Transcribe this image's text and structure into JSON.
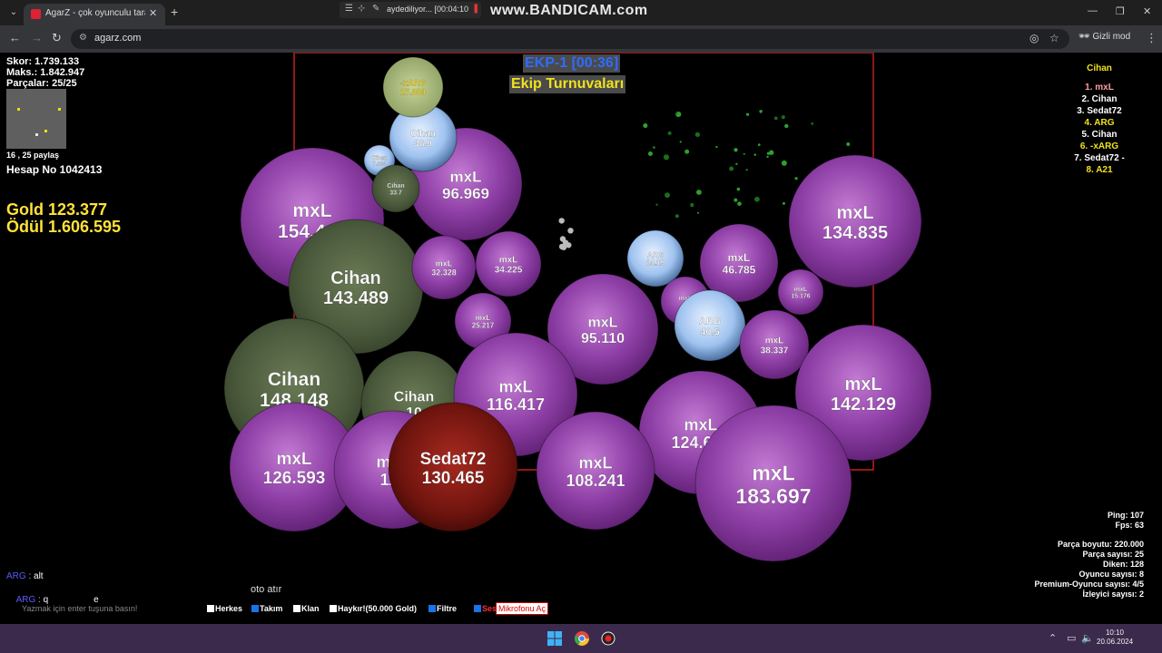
{
  "browser": {
    "tab_title": "AgarZ - çok oyunculu tarayıcı o",
    "url": "agarz.com",
    "incognito_label": "Gizli mod",
    "recorder_text": "aydediliyor... [00:04:10",
    "watermark": "www.BANDICAM.com"
  },
  "game": {
    "stats": {
      "score": "Skor: 1.739.133",
      "max": "Maks.: 1.842.947",
      "parts": "Parçalar: 25/25"
    },
    "share_text": "16 , 25 paylaş",
    "account": "Hesap No 1042413",
    "gold": "Gold 123.377",
    "reward": "Ödül 1.606.595",
    "team_timer": "EKP-1 [00:36]",
    "tournament": "Ekip Turnuvaları",
    "leaderboard": {
      "header": "Cihan",
      "rows": [
        {
          "text": "1. mxL",
          "color": "#ff9ea0"
        },
        {
          "text": "2. Cihan",
          "color": "#ffffff"
        },
        {
          "text": "3. Sedat72",
          "color": "#ffffff"
        },
        {
          "text": "4. ARG",
          "color": "#f0e21e"
        },
        {
          "text": "5. Cihan",
          "color": "#ffffff"
        },
        {
          "text": "6. -xARG",
          "color": "#f0e21e"
        },
        {
          "text": "7. Sedat72 -",
          "color": "#ffffff"
        },
        {
          "text": "8. A21",
          "color": "#f0e21e"
        }
      ]
    },
    "net": {
      "ping": "Ping: 107",
      "fps": "Fps: 63"
    },
    "server": {
      "part_size": "Parça boyutu: 220.000",
      "part_count": "Parça sayısı: 25",
      "spikes": "Diken: 128",
      "players": "Oyuncu sayısı: 8",
      "premium": "Premium-Oyuncu sayısı: 4/5",
      "spectators": "İzleyici sayısı: 2"
    },
    "chat": [
      {
        "name": "ARG",
        "sep": " : ",
        "msg": "alt"
      },
      {
        "name": "ARG",
        "sep": " : ",
        "msg": "q                  e"
      }
    ],
    "auto_fire": "oto atır",
    "chat_placeholder": "Yazmak için enter tuşuna basın!",
    "options": [
      {
        "label": "Herkes",
        "checked": false
      },
      {
        "label": "Takım",
        "checked": true
      },
      {
        "label": "Klan",
        "checked": false
      },
      {
        "label": "Haykır!(50.000 Gold)",
        "checked": false
      },
      {
        "label": "Filtre",
        "checked": true
      },
      {
        "label": "Ses",
        "checked": true
      }
    ],
    "mic_button": "Mikrofonu Aç",
    "cells": [
      {
        "name": "mxL",
        "mass": "154.449",
        "type": "mxl"
      },
      {
        "name": "Cihan",
        "mass": "143.489",
        "type": "cihan"
      },
      {
        "name": "mxL",
        "mass": "96.969",
        "type": "mxl"
      },
      {
        "name": "Cihan",
        "mass": "36.9",
        "type": "blue"
      },
      {
        "name": "-xARG",
        "mass": "27.889",
        "type": "argg"
      },
      {
        "name": "Cihan",
        "mass": "7.334",
        "type": "blue"
      },
      {
        "name": "Cihan",
        "mass": "33.7",
        "type": "cihan"
      },
      {
        "name": "mxL",
        "mass": "32.328",
        "type": "mxl"
      },
      {
        "name": "mxL",
        "mass": "34.225",
        "type": "mxl"
      },
      {
        "name": "mxL",
        "mass": "25.217",
        "type": "mxl"
      },
      {
        "name": "mxL",
        "mass": "95.110",
        "type": "mxl"
      },
      {
        "name": "ARG",
        "mass": "24.19",
        "type": "blue"
      },
      {
        "name": "mxL",
        "mass": "46.785",
        "type": "mxl"
      },
      {
        "name": "mxL",
        "mass": "",
        "type": "mxl"
      },
      {
        "name": "ARG",
        "mass": "40.5",
        "type": "blue"
      },
      {
        "name": "mxL",
        "mass": "15.176",
        "type": "mxl"
      },
      {
        "name": "mxL",
        "mass": "38.337",
        "type": "mxl"
      },
      {
        "name": "mxL",
        "mass": "134.835",
        "type": "mxl"
      },
      {
        "name": "Cihan",
        "mass": "148.148",
        "type": "cihan"
      },
      {
        "name": "Cihan",
        "mass": "10",
        "type": "cihan"
      },
      {
        "name": "mxL",
        "mass": "116.417",
        "type": "mxl"
      },
      {
        "name": "mxL",
        "mass": "124.679",
        "type": "mxl"
      },
      {
        "name": "mxL",
        "mass": "142.129",
        "type": "mxl"
      },
      {
        "name": "mxL",
        "mass": "126.593",
        "type": "mxl"
      },
      {
        "name": "mxL",
        "mass": "119",
        "type": "mxl"
      },
      {
        "name": "Sedat72",
        "mass": "130.465",
        "type": "sedat"
      },
      {
        "name": "mxL",
        "mass": "108.241",
        "type": "mxl"
      },
      {
        "name": "mxL",
        "mass": "183.697",
        "type": "mxl"
      }
    ]
  },
  "taskbar": {
    "time": "10:10",
    "date": "20.06.2024"
  }
}
